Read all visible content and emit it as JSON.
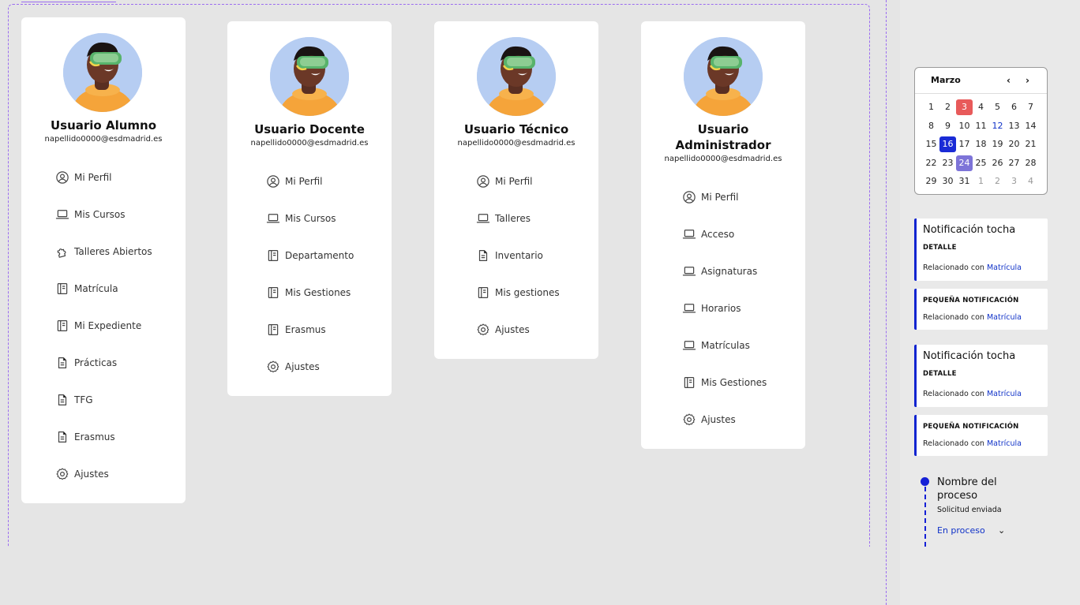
{
  "cards": [
    {
      "name": "Usuario Alumno",
      "email": "napellido0000@esdmadrid.es",
      "menu": [
        {
          "label": "Mi Perfil",
          "icon": "user-circle-icon"
        },
        {
          "label": "Mis Cursos",
          "icon": "laptop-icon"
        },
        {
          "label": "Talleres Abiertos",
          "icon": "puzzle-icon"
        },
        {
          "label": "Matrícula",
          "icon": "notebook-icon"
        },
        {
          "label": "Mi Expediente",
          "icon": "notebook-icon"
        },
        {
          "label": "Prácticas",
          "icon": "document-icon"
        },
        {
          "label": "TFG",
          "icon": "document-icon"
        },
        {
          "label": "Erasmus",
          "icon": "document-icon"
        },
        {
          "label": "Ajustes",
          "icon": "gear-icon"
        }
      ]
    },
    {
      "name": "Usuario Docente",
      "email": "napellido0000@esdmadrid.es",
      "menu": [
        {
          "label": "Mi Perfil",
          "icon": "user-circle-icon"
        },
        {
          "label": "Mis Cursos",
          "icon": "laptop-icon"
        },
        {
          "label": "Departamento",
          "icon": "notebook-icon"
        },
        {
          "label": "Mis Gestiones",
          "icon": "notebook-icon"
        },
        {
          "label": "Erasmus",
          "icon": "notebook-icon"
        },
        {
          "label": "Ajustes",
          "icon": "gear-icon"
        }
      ]
    },
    {
      "name": "Usuario Técnico",
      "email": "napellido0000@esdmadrid.es",
      "menu": [
        {
          "label": "Mi Perfil",
          "icon": "user-circle-icon"
        },
        {
          "label": "Talleres",
          "icon": "laptop-icon"
        },
        {
          "label": "Inventario",
          "icon": "document-icon"
        },
        {
          "label": "Mis gestiones",
          "icon": "notebook-icon"
        },
        {
          "label": "Ajustes",
          "icon": "gear-icon"
        }
      ]
    },
    {
      "name_line1": "Usuario",
      "name_line2": "Administrador",
      "email": "napellido0000@esdmadrid.es",
      "menu": [
        {
          "label": "Mi Perfil",
          "icon": "user-circle-icon"
        },
        {
          "label": "Acceso",
          "icon": "laptop-icon"
        },
        {
          "label": "Asignaturas",
          "icon": "laptop-icon"
        },
        {
          "label": "Horarios",
          "icon": "laptop-icon"
        },
        {
          "label": "Matrículas",
          "icon": "laptop-icon"
        },
        {
          "label": "Mis Gestiones",
          "icon": "notebook-icon"
        },
        {
          "label": "Ajustes",
          "icon": "gear-icon"
        }
      ]
    }
  ],
  "calendar": {
    "month": "Marzo",
    "prev": "‹",
    "next": "›",
    "days": [
      {
        "d": "1"
      },
      {
        "d": "2"
      },
      {
        "d": "3",
        "style": "today"
      },
      {
        "d": "4"
      },
      {
        "d": "5"
      },
      {
        "d": "6"
      },
      {
        "d": "7"
      },
      {
        "d": "8"
      },
      {
        "d": "9"
      },
      {
        "d": "10"
      },
      {
        "d": "11"
      },
      {
        "d": "12",
        "style": "blue-text"
      },
      {
        "d": "13"
      },
      {
        "d": "14"
      },
      {
        "d": "15"
      },
      {
        "d": "16",
        "style": "selected"
      },
      {
        "d": "17"
      },
      {
        "d": "18"
      },
      {
        "d": "19"
      },
      {
        "d": "20"
      },
      {
        "d": "21"
      },
      {
        "d": "22"
      },
      {
        "d": "23"
      },
      {
        "d": "24",
        "style": "event"
      },
      {
        "d": "25"
      },
      {
        "d": "26"
      },
      {
        "d": "27"
      },
      {
        "d": "28"
      },
      {
        "d": "29"
      },
      {
        "d": "30"
      },
      {
        "d": "31"
      },
      {
        "d": "1",
        "style": "dim"
      },
      {
        "d": "2",
        "style": "dim"
      },
      {
        "d": "3",
        "style": "dim"
      },
      {
        "d": "4",
        "style": "dim"
      }
    ],
    "colors": {
      "today": "#e85a5a",
      "selected": "#1a2bd6",
      "event": "#7d74d8",
      "blue_text": "#1032c8"
    }
  },
  "notifications": [
    {
      "title": "Notificación tocha",
      "detail": "DETALLE",
      "related_prefix": "Relacionado con",
      "related_link": "Matrícula"
    },
    {
      "detail": "PEQUEÑA NOTIFICACIÓN",
      "related_prefix": "Relacionado con",
      "related_link": "Matrícula"
    },
    {
      "title": "Notificación tocha",
      "detail": "DETALLE",
      "related_prefix": "Relacionado con",
      "related_link": "Matrícula"
    },
    {
      "detail": "PEQUEÑA NOTIFICACIÓN",
      "related_prefix": "Relacionado con",
      "related_link": "Matrícula"
    }
  ],
  "process": {
    "name": "Nombre del proceso",
    "subtitle": "Solicitud enviada",
    "status": "En proceso",
    "chevron": "⌄"
  },
  "colors": {
    "accent": "#1520d6",
    "frame": "#9b6cf0",
    "background": "#e5e5e5"
  }
}
